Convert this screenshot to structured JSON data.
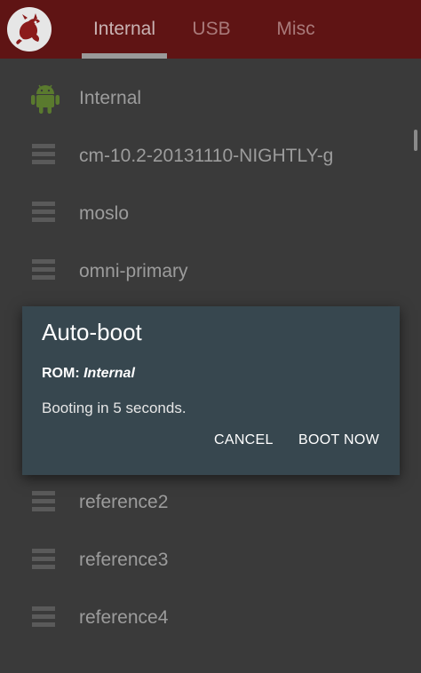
{
  "tabs": [
    {
      "label": "Internal",
      "active": true
    },
    {
      "label": "USB",
      "active": false
    },
    {
      "label": "Misc",
      "active": false
    }
  ],
  "rom_list": [
    {
      "label": "Internal",
      "icon": "android-icon"
    },
    {
      "label": "cm-10.2-20131110-NIGHTLY-g",
      "icon": "menu-icon"
    },
    {
      "label": "moslo",
      "icon": "menu-icon"
    },
    {
      "label": "omni-primary",
      "icon": "menu-icon"
    },
    {
      "label": "reference2",
      "icon": "menu-icon"
    },
    {
      "label": "reference3",
      "icon": "menu-icon"
    },
    {
      "label": "reference4",
      "icon": "menu-icon"
    }
  ],
  "dialog": {
    "title": "Auto-boot",
    "rom_prefix": "ROM:",
    "rom_name": "Internal",
    "message": "Booting in 5 seconds.",
    "cancel_label": "CANCEL",
    "boot_label": "BOOT NOW"
  },
  "colors": {
    "appbar": "#5f1414",
    "dialog_bg": "#37474f",
    "android_green": "#5a7a2e"
  }
}
